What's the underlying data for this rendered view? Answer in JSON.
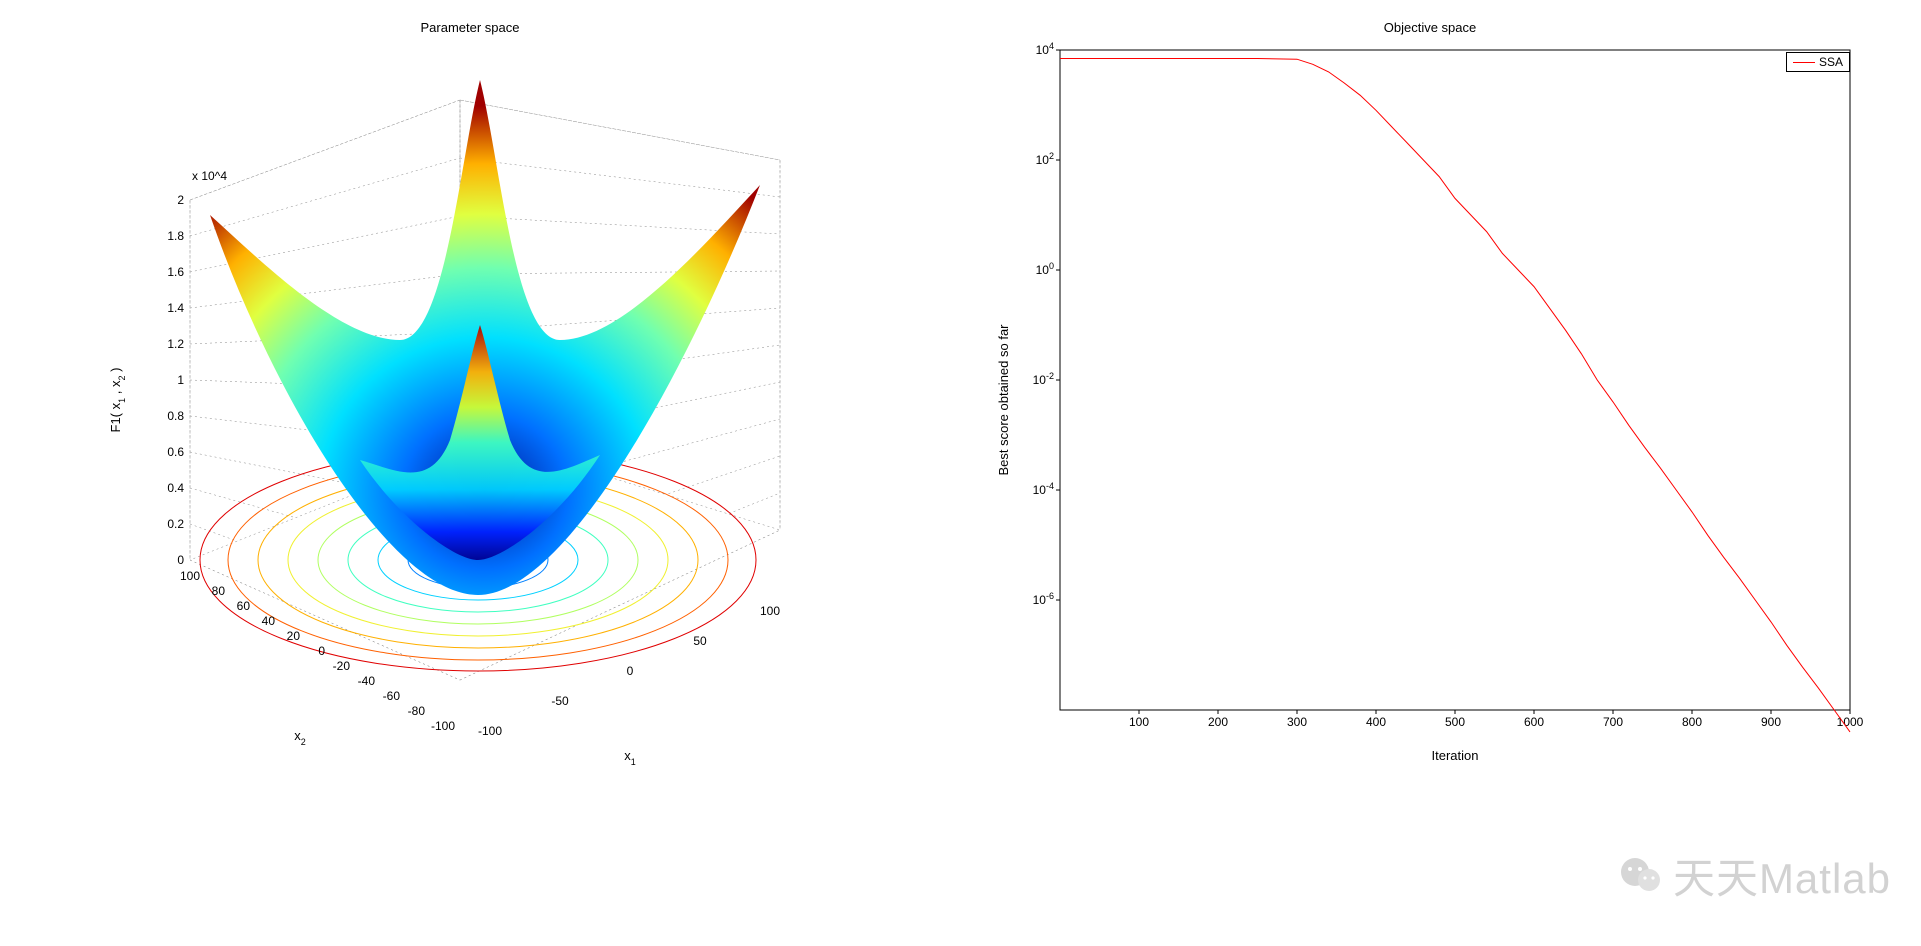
{
  "left_panel": {
    "title": "Parameter space",
    "xlabel": "x_1",
    "ylabel": "x_2",
    "zlabel": "F1( x_1 , x_2 )",
    "z_multiplier_label": "x 10^4",
    "x_ticks": [
      -100,
      -50,
      0,
      50,
      100
    ],
    "y_ticks": [
      -100,
      -80,
      -60,
      -40,
      -20,
      0,
      20,
      40,
      60,
      80,
      100
    ],
    "z_ticks": [
      0,
      0.2,
      0.4,
      0.6,
      0.8,
      1,
      1.2,
      1.4,
      1.6,
      1.8,
      2
    ]
  },
  "right_panel": {
    "title": "Objective space",
    "xlabel": "Iteration",
    "ylabel": "Best score obtained so far",
    "legend": "SSA",
    "x_ticks": [
      100,
      200,
      300,
      400,
      500,
      600,
      700,
      800,
      900,
      1000
    ],
    "y_ticks_exp": [
      -6,
      -4,
      -2,
      0,
      2,
      4
    ]
  },
  "watermark": "天天Matlab",
  "chart_data": [
    {
      "type": "surface3d",
      "title": "Parameter space",
      "xlabel": "x_1",
      "ylabel": "x_2",
      "zlabel": "F1( x_1 , x_2 )",
      "xlim": [
        -100,
        100
      ],
      "ylim": [
        -100,
        100
      ],
      "zlim": [
        0,
        20000
      ],
      "function": "F1(x1,x2) = x1^2 + x2^2",
      "colormap": "jet",
      "contour_on_floor": true
    },
    {
      "type": "line",
      "title": "Objective space",
      "xlabel": "Iteration",
      "ylabel": "Best score obtained so far",
      "xlim": [
        0,
        1000
      ],
      "ylim": [
        1e-08,
        10000.0
      ],
      "yscale": "log",
      "legend_position": "northeast",
      "series": [
        {
          "name": "SSA",
          "color": "#ff0000",
          "x": [
            0,
            50,
            100,
            150,
            200,
            250,
            300,
            320,
            340,
            360,
            380,
            400,
            420,
            440,
            460,
            480,
            500,
            520,
            540,
            560,
            580,
            600,
            620,
            640,
            660,
            680,
            700,
            720,
            740,
            760,
            780,
            800,
            820,
            840,
            860,
            880,
            900,
            920,
            940,
            960,
            980,
            1000
          ],
          "y": [
            7000,
            7000,
            7000,
            7000,
            7000,
            7000,
            6800,
            5500,
            4000,
            2500,
            1500,
            800,
            400,
            200,
            100,
            50,
            20,
            10,
            5,
            2,
            1,
            0.5,
            0.2,
            0.08,
            0.03,
            0.01,
            0.004,
            0.0015,
            0.0006,
            0.00025,
            0.0001,
            4e-05,
            1.5e-05,
            6e-06,
            2.5e-06,
            1e-06,
            4e-07,
            1.5e-07,
            6e-08,
            2.5e-08,
            1e-08,
            4e-09
          ]
        }
      ]
    }
  ]
}
